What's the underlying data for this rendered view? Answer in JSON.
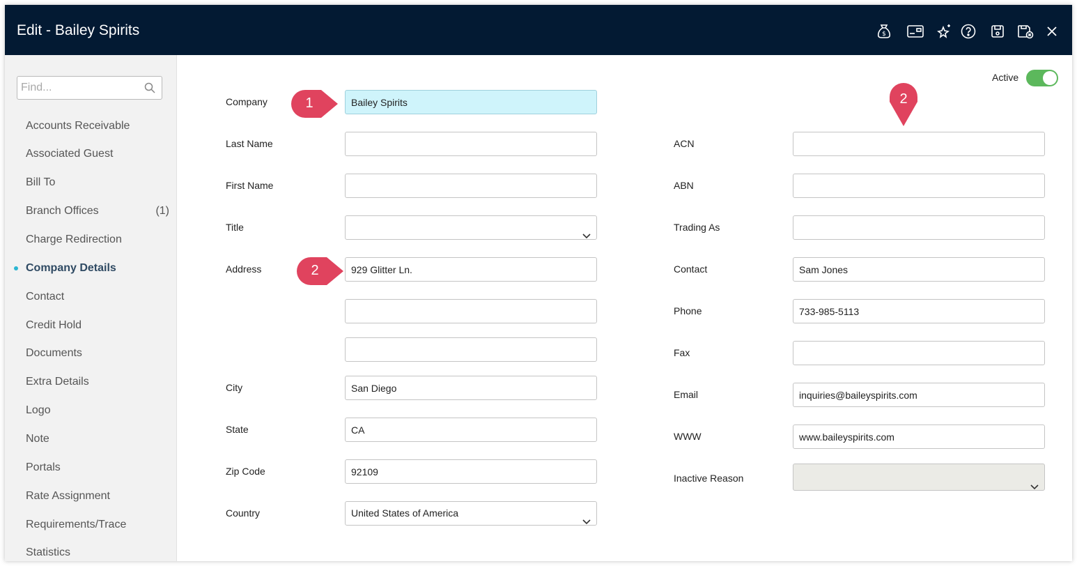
{
  "window": {
    "title": "Edit - Bailey Spirits"
  },
  "toolbar": {
    "icons": [
      "money-bag-icon",
      "card-icon",
      "sparkle-star-icon",
      "help-icon",
      "save-icon",
      "save-close-icon",
      "close-icon"
    ]
  },
  "sidebar": {
    "search_placeholder": "Find...",
    "items": [
      {
        "label": "Accounts Receivable"
      },
      {
        "label": "Associated Guest"
      },
      {
        "label": "Bill To"
      },
      {
        "label": "Branch Offices",
        "count": "(1)"
      },
      {
        "label": "Charge Redirection"
      },
      {
        "label": "Company Details",
        "active": true
      },
      {
        "label": "Contact"
      },
      {
        "label": "Credit Hold"
      },
      {
        "label": "Documents"
      },
      {
        "label": "Extra Details"
      },
      {
        "label": "Logo"
      },
      {
        "label": "Note"
      },
      {
        "label": "Portals"
      },
      {
        "label": "Rate Assignment"
      },
      {
        "label": "Requirements/Trace"
      },
      {
        "label": "Statistics"
      }
    ]
  },
  "status": {
    "active_label": "Active",
    "active_on": true
  },
  "form": {
    "company": {
      "label": "Company",
      "value": "Bailey Spirits"
    },
    "last_name": {
      "label": "Last Name",
      "value": ""
    },
    "first_name": {
      "label": "First Name",
      "value": ""
    },
    "title": {
      "label": "Title",
      "value": ""
    },
    "address": {
      "label": "Address",
      "line1": "929 Glitter Ln.",
      "line2": "",
      "line3": ""
    },
    "city": {
      "label": "City",
      "value": "San Diego"
    },
    "state": {
      "label": "State",
      "value": "CA"
    },
    "zip": {
      "label": "Zip Code",
      "value": "92109"
    },
    "country": {
      "label": "Country",
      "value": "United States of America"
    },
    "acn": {
      "label": "ACN",
      "value": ""
    },
    "abn": {
      "label": "ABN",
      "value": ""
    },
    "trading_as": {
      "label": "Trading As",
      "value": ""
    },
    "contact": {
      "label": "Contact",
      "value": "Sam Jones"
    },
    "phone": {
      "label": "Phone",
      "value": "733-985-5113"
    },
    "fax": {
      "label": "Fax",
      "value": ""
    },
    "email": {
      "label": "Email",
      "value": "inquiries@baileyspirits.com"
    },
    "www": {
      "label": "WWW",
      "value": "www.baileyspirits.com"
    },
    "inactive_reason": {
      "label": "Inactive Reason",
      "value": ""
    }
  },
  "callouts": {
    "one": "1",
    "two": "2"
  },
  "colors": {
    "titlebar": "#031a33",
    "accent": "#2bb6d2",
    "toggle": "#5cb85c",
    "callout": "#e0435e",
    "company_highlight": "#cff4fb"
  }
}
